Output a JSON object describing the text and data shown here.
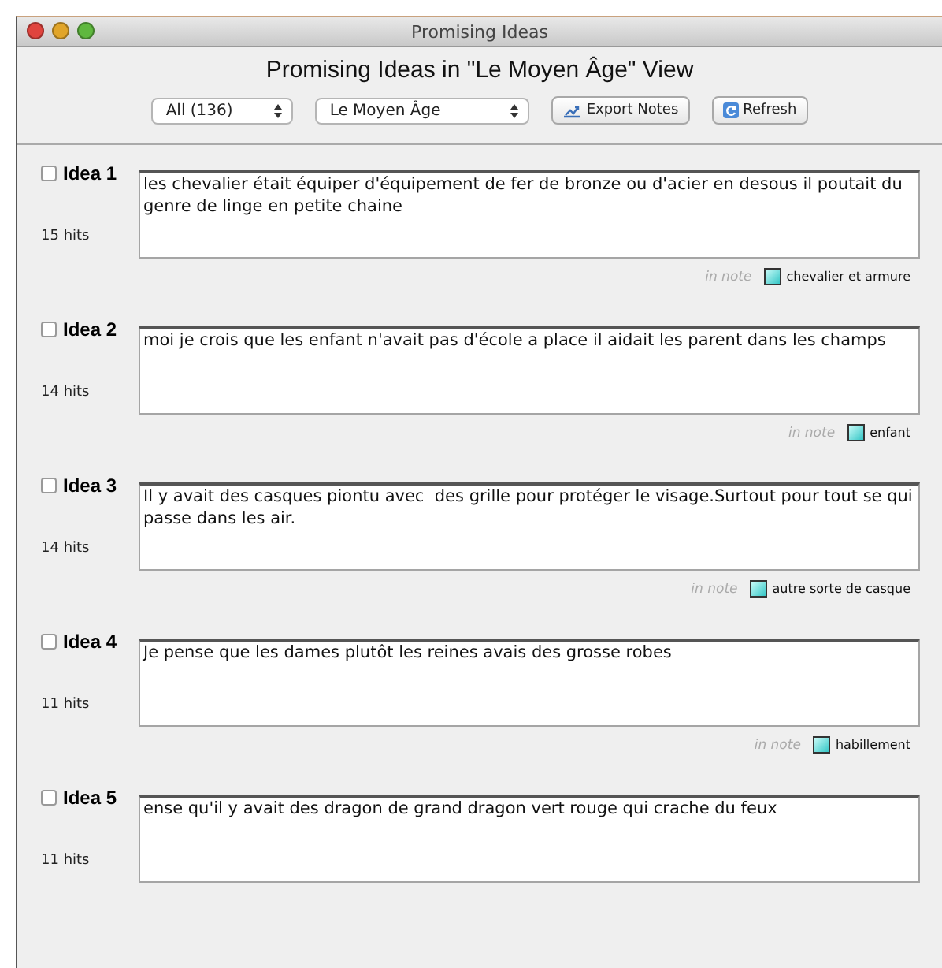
{
  "window": {
    "title": "Promising Ideas"
  },
  "heading": "Promising Ideas in \"Le Moyen Âge\" View",
  "toolbar": {
    "filter_select": "All (136)",
    "view_select": "Le Moyen Âge",
    "buttons": [
      {
        "kind": "export",
        "label": "Export Notes"
      },
      {
        "kind": "refresh",
        "label": "Refresh"
      }
    ]
  },
  "ideas": [
    {
      "title": "Idea 1",
      "checked": false,
      "hits": "15 hits",
      "text": "les chevalier était équiper d'équipement de fer de bronze ou d'acier en desous il poutait du genre de linge en petite chaine",
      "note_label": "in note",
      "note": "chevalier et armure"
    },
    {
      "title": "Idea 2",
      "checked": false,
      "hits": "14 hits",
      "text": "moi je crois que les enfant n'avait pas d'école a place il aidait les parent dans les champs",
      "note_label": "in note",
      "note": "enfant"
    },
    {
      "title": "Idea 3",
      "checked": false,
      "hits": "14 hits",
      "text": "Il y avait des casques piontu avec  des grille pour protéger le visage.Surtout pour tout se qui passe dans les air.",
      "note_label": "in note",
      "note": "autre sorte de casque"
    },
    {
      "title": "Idea 4",
      "checked": false,
      "hits": "11 hits",
      "text": "Je pense que les dames plutôt les reines avais des grosse robes",
      "note_label": "in note",
      "note": "habillement"
    },
    {
      "title": "Idea 5",
      "checked": false,
      "hits": "11 hits",
      "text": "ense qu'il y avait des dragon de grand dragon vert rouge qui crache du feux"
    }
  ]
}
